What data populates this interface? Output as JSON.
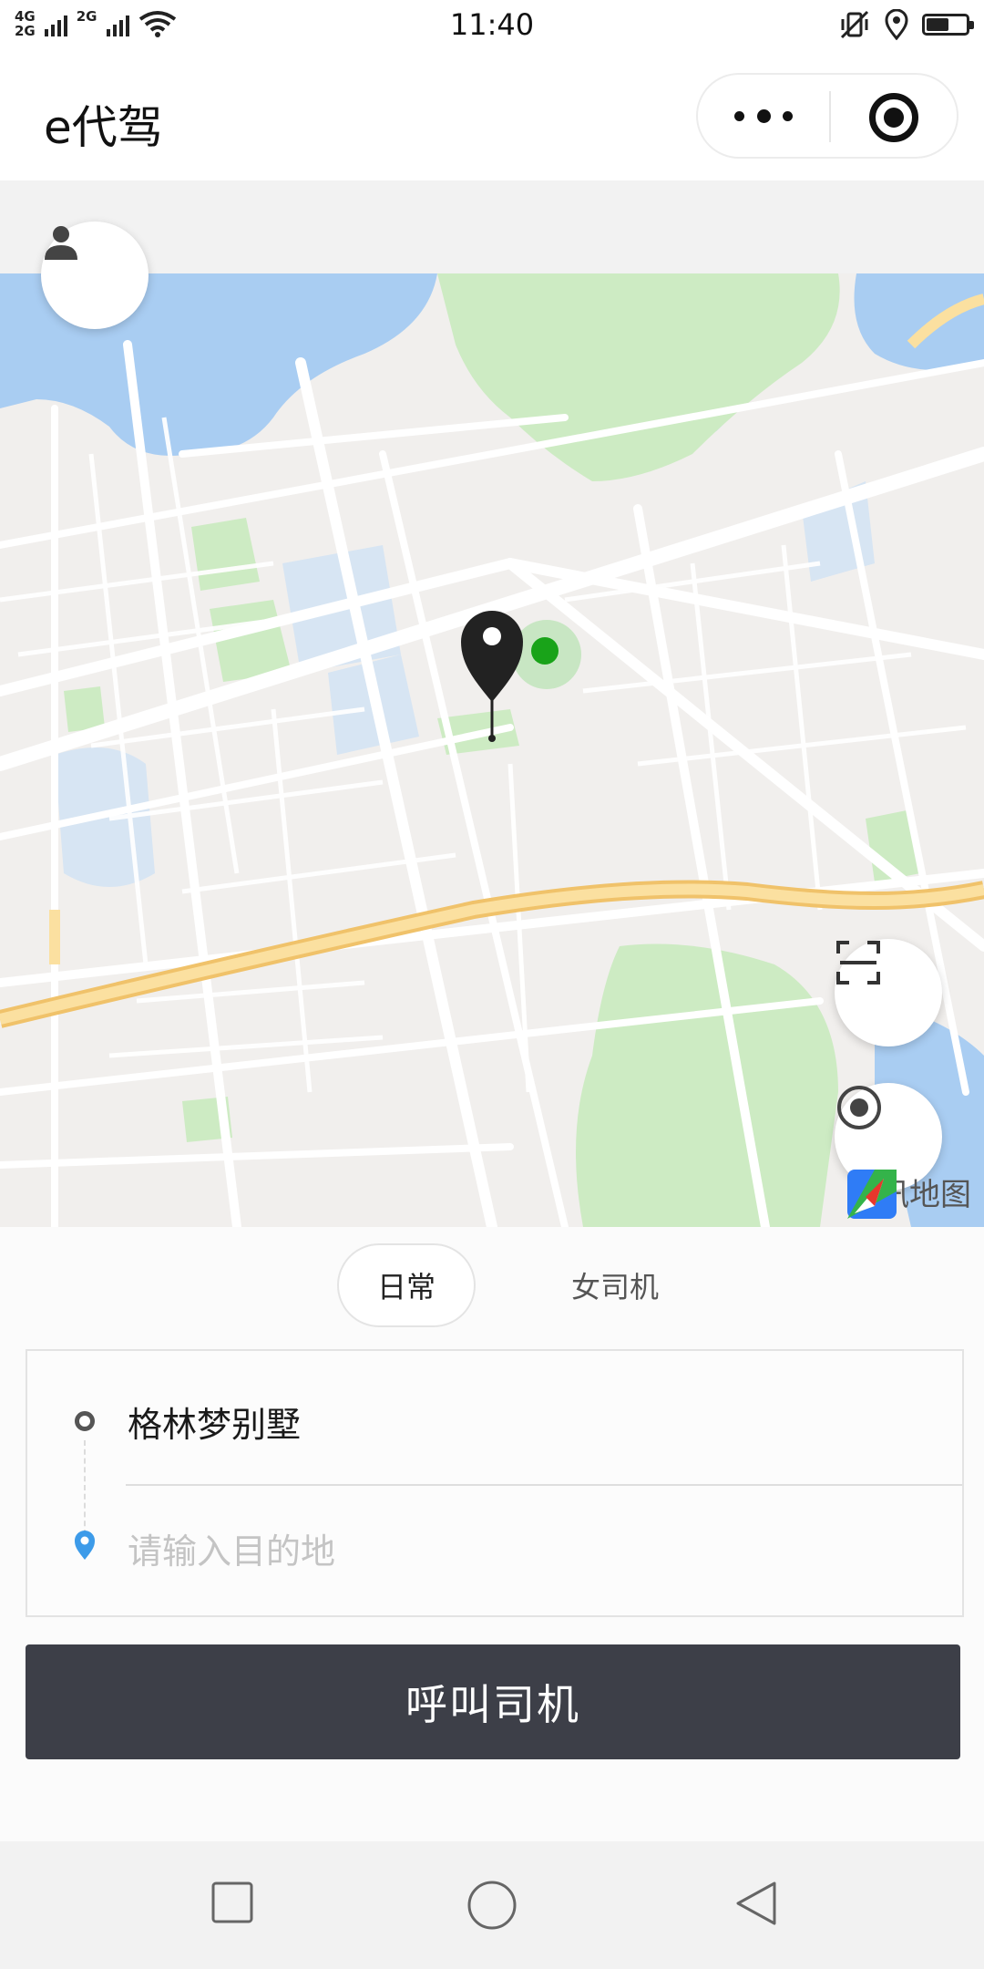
{
  "status_bar": {
    "network_top": "4G",
    "network_bottom": "2G",
    "network_2": "2G",
    "time": "11:40"
  },
  "header": {
    "title": "e代驾",
    "more_icon": "more-dots-icon",
    "close_icon": "target-close-icon"
  },
  "map": {
    "provider_name": "腾讯地图",
    "profile_icon": "person-icon",
    "scan_icon": "scan-frame-icon",
    "locate_icon": "locate-icon",
    "colors": {
      "land": "#f1efed",
      "water": "#a9cdf2",
      "park": "#cdebc3",
      "road": "#ffffff",
      "highway": "#f8d88a",
      "pin": "#222222",
      "car": "#19a319"
    }
  },
  "tabs": {
    "items": [
      {
        "label": "日常",
        "active": true
      },
      {
        "label": "女司机",
        "active": false
      }
    ]
  },
  "trip": {
    "start_address": "格林梦别墅",
    "destination_value": "",
    "destination_placeholder": "请输入目的地"
  },
  "actions": {
    "call_label": "呼叫司机"
  },
  "nav": {
    "icons": [
      "square-recent-icon",
      "circle-home-icon",
      "triangle-back-icon"
    ]
  }
}
